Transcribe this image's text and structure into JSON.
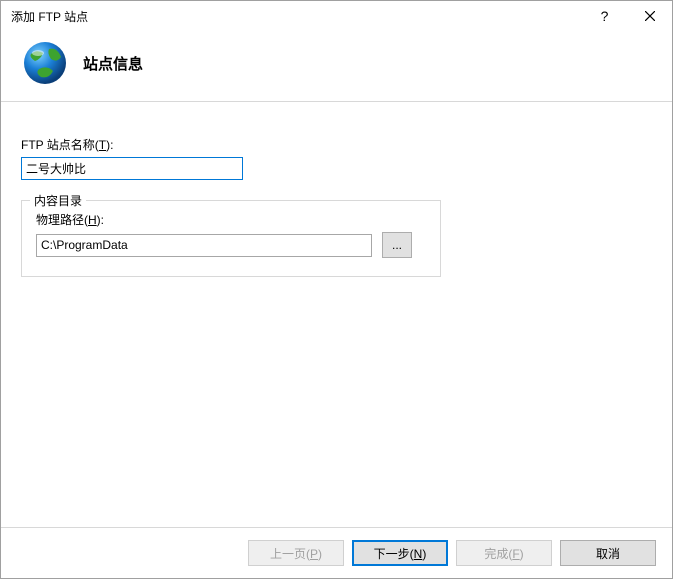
{
  "titlebar": {
    "title": "添加 FTP 站点"
  },
  "header": {
    "title": "站点信息"
  },
  "form": {
    "site_name_label_prefix": "FTP 站点名称(",
    "site_name_label_key": "T",
    "site_name_label_suffix": "):",
    "site_name_value": "二号大帅比",
    "groupbox_title": "内容目录",
    "path_label_prefix": "物理路径(",
    "path_label_key": "H",
    "path_label_suffix": "):",
    "path_value": "C:\\ProgramData",
    "browse_label": "..."
  },
  "footer": {
    "prev_prefix": "上一页(",
    "prev_key": "P",
    "prev_suffix": ")",
    "next_prefix": "下一步(",
    "next_key": "N",
    "next_suffix": ")",
    "finish_prefix": "完成(",
    "finish_key": "F",
    "finish_suffix": ")",
    "cancel": "取消"
  }
}
